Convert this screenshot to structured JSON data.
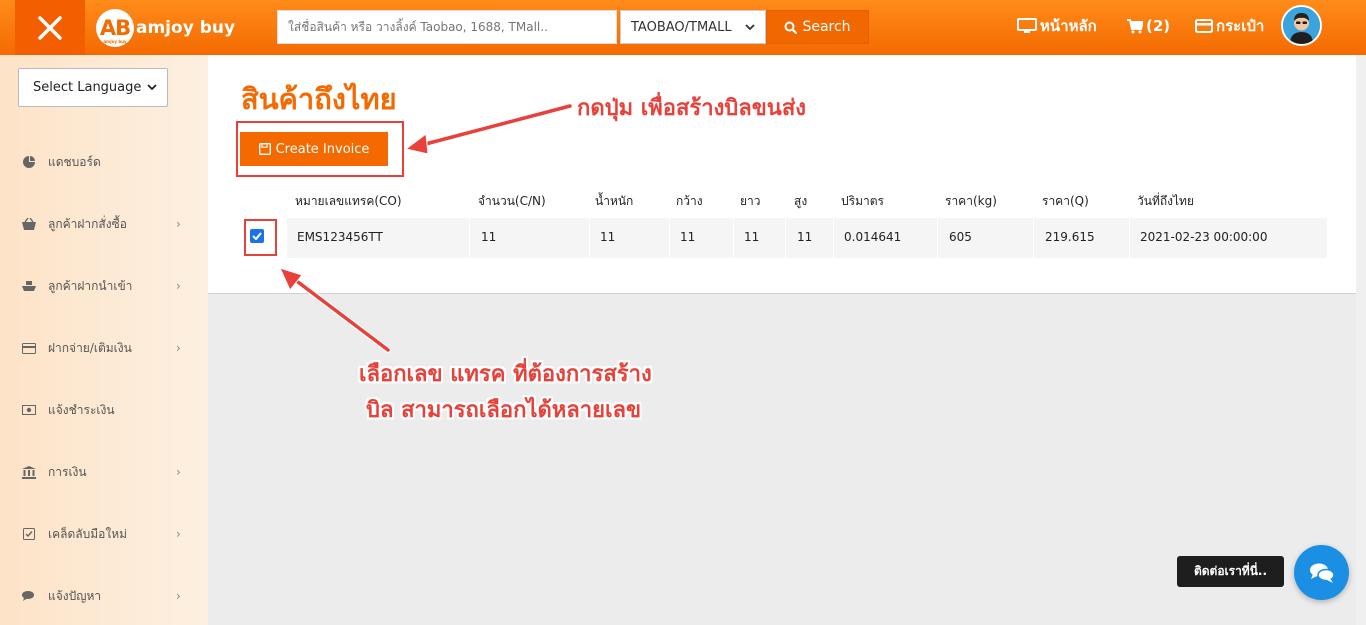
{
  "header": {
    "logo_mark": "AB",
    "logo_sub": "amjoy buy",
    "logo_text": "amjoy buy",
    "search_placeholder": "ใส่ชื่อสินค้า หรือ วางลิ้งค์ Taobao, 1688, TMall..",
    "platform_selected": "TAOBAO/TMALL",
    "search_label": "Search",
    "nav_home": "หน้าหลัก",
    "nav_cart": "(2)",
    "nav_wallet": "กระเป๋า"
  },
  "sidebar": {
    "language_label": "Select Language",
    "items": [
      {
        "label": "แดชบอร์ด",
        "icon": "pie-chart-icon",
        "has_chevron": false
      },
      {
        "label": "ลูกค้าฝากสั่งซื้อ",
        "icon": "basket-icon",
        "has_chevron": true
      },
      {
        "label": "ลูกค้าฝากนำเข้า",
        "icon": "ship-icon",
        "has_chevron": true
      },
      {
        "label": "ฝากจ่าย/เติมเงิน",
        "icon": "credit-card-icon",
        "has_chevron": true
      },
      {
        "label": "แจ้งชำระเงิน",
        "icon": "money-icon",
        "has_chevron": false
      },
      {
        "label": "การเงิน",
        "icon": "bank-icon",
        "has_chevron": true
      },
      {
        "label": "เคล็ดลับมือใหม่",
        "icon": "checkbox-icon",
        "has_chevron": true
      },
      {
        "label": "แจ้งปัญหา",
        "icon": "comments-icon",
        "has_chevron": true
      }
    ]
  },
  "main": {
    "title": "สินค้าถึงไทย",
    "create_invoice_label": "Create Invoice",
    "columns": [
      "หมายเลขแทรค(CO)",
      "จำนวน(C/N)",
      "น้ำหนัก",
      "กว้าง",
      "ยาว",
      "สูง",
      "ปริมาตร",
      "ราคา(kg)",
      "ราคา(Q)",
      "วันที่ถึงไทย"
    ],
    "rows": [
      {
        "checked": true,
        "cells": [
          "EMS123456TT",
          "11",
          "11",
          "11",
          "11",
          "11",
          "0.014641",
          "605",
          "219.615",
          "2021-02-23 00:00:00"
        ]
      }
    ]
  },
  "annotations": {
    "create_hint": "กดปุ่ม เพื่อสร้างบิลขนส่ง",
    "select_hint_line1": "เลือกเลข แทรค ที่ต้องการสร้าง",
    "select_hint_line2": "บิล สามารถเลือกได้หลายเลข",
    "color": "#e8413a"
  },
  "contact": {
    "label": "ติดต่อเราที่นี่.."
  },
  "colors": {
    "brand": "#f46a00",
    "sidebar_bg": "#fde3c7",
    "chat": "#1a8fe3"
  }
}
